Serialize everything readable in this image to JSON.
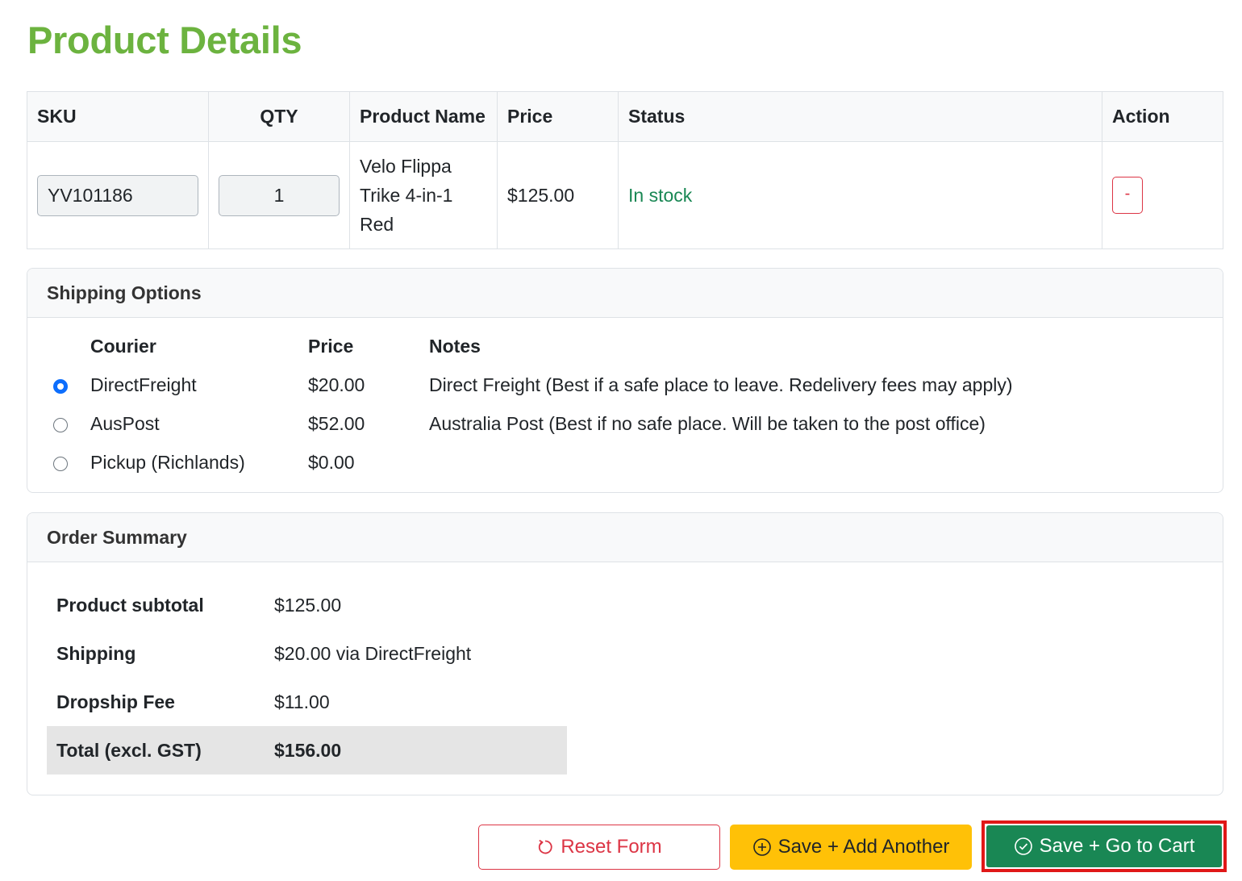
{
  "page": {
    "title": "Product Details"
  },
  "product_table": {
    "headers": {
      "sku": "SKU",
      "qty": "QTY",
      "product_name": "Product Name",
      "price": "Price",
      "status": "Status",
      "action": "Action"
    },
    "rows": [
      {
        "sku": "YV101186",
        "qty": "1",
        "product_name_lines": [
          "Velo Flippa",
          "Trike 4-in-1",
          "Red"
        ],
        "price": "$125.00",
        "status": "In stock",
        "status_color": "#198754",
        "remove_label": "-"
      }
    ]
  },
  "shipping": {
    "title": "Shipping Options",
    "headers": {
      "courier": "Courier",
      "price": "Price",
      "notes": "Notes"
    },
    "options": [
      {
        "courier": "DirectFreight",
        "price": "$20.00",
        "notes": "Direct Freight (Best if a safe place to leave. Redelivery fees may apply)",
        "selected": true
      },
      {
        "courier": "AusPost",
        "price": "$52.00",
        "notes": "Australia Post (Best if no safe place. Will be taken to the post office)",
        "selected": false
      },
      {
        "courier": "Pickup (Richlands)",
        "price": "$0.00",
        "notes": "",
        "selected": false
      }
    ]
  },
  "summary": {
    "title": "Order Summary",
    "rows": [
      {
        "label": "Product subtotal",
        "value": "$125.00"
      },
      {
        "label": "Shipping",
        "value": "$20.00 via DirectFreight"
      },
      {
        "label": "Dropship Fee",
        "value": "$11.00"
      },
      {
        "label": "Total (excl. GST)",
        "value": "$156.00"
      }
    ]
  },
  "buttons": {
    "reset": "Reset Form",
    "add_another": "Save + Add Another",
    "go_to_cart": "Save + Go to Cart"
  },
  "icons": {
    "reset": "refresh-icon",
    "add": "plus-circle-icon",
    "cart": "check-circle-icon"
  },
  "colors": {
    "title": "#6cb33f",
    "danger": "#dc3545",
    "warning": "#ffc107",
    "success": "#198754",
    "highlight_border": "#e01818",
    "radio_selected": "#0d6efd"
  }
}
